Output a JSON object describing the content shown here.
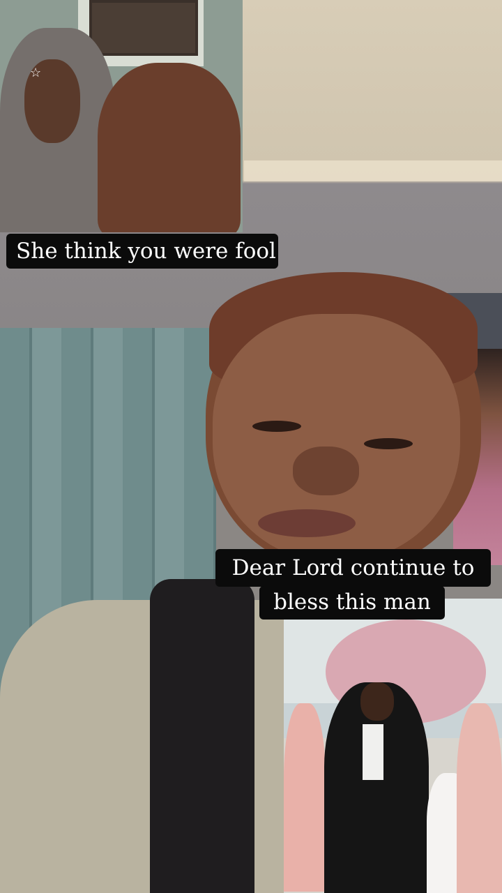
{
  "captions": {
    "top": "She think you were fool",
    "middle_line1": "Dear Lord continue to",
    "middle_line2": "bless this man"
  }
}
